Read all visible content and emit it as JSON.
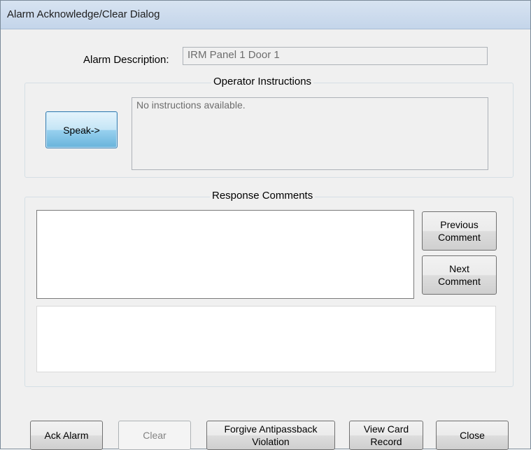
{
  "window": {
    "title": "Alarm Acknowledge/Clear Dialog"
  },
  "alarm_description": {
    "label": "Alarm Description:",
    "value": "IRM Panel 1 Door 1"
  },
  "operator_instructions": {
    "group_title": "Operator Instructions",
    "speak_button": "Speak->",
    "text": "No instructions available."
  },
  "response_comments": {
    "group_title": "Response Comments",
    "comment_list_value": "",
    "previous_comment_button": "Previous\nComment",
    "next_comment_button": "Next\nComment",
    "comment_input_value": ""
  },
  "footer": {
    "ack_alarm_button": "Ack Alarm",
    "clear_button": "Clear",
    "forgive_button": "Forgive Antipassback\nViolation",
    "view_card_button": "View Card\nRecord",
    "close_button": "Close"
  }
}
